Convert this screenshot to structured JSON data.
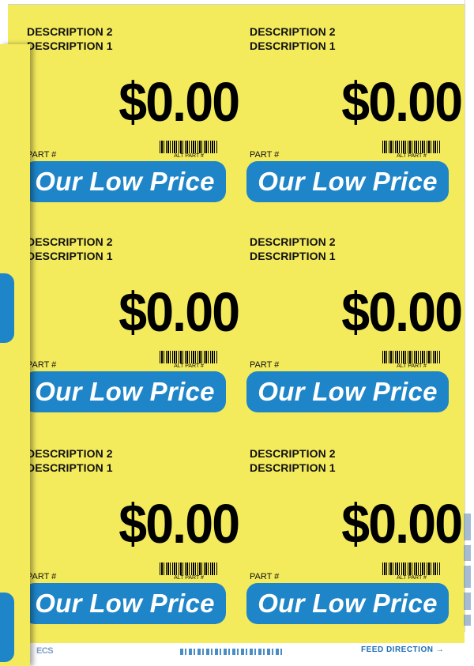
{
  "labels": [
    {
      "description2": "DESCRIPTION 2",
      "description1": "DESCRIPTION 1",
      "price": "$0.00",
      "part": "PART #",
      "alt_part": "ALT PART #",
      "tagline": "Our Low Price"
    },
    {
      "description2": "DESCRIPTION 2",
      "description1": "DESCRIPTION 1",
      "price": "$0.00",
      "part": "PART #",
      "alt_part": "ALT PART #",
      "tagline": "Our Low Price"
    },
    {
      "description2": "DESCRIPTION 2",
      "description1": "DESCRIPTION 1",
      "price": "$0.00",
      "part": "PART #",
      "alt_part": "ALT PART #",
      "tagline": "Our Low Price"
    },
    {
      "description2": "DESCRIPTION 2",
      "description1": "DESCRIPTION 1",
      "price": "$0.00",
      "part": "PART #",
      "alt_part": "ALT PART #",
      "tagline": "Our Low Price"
    },
    {
      "description2": "DESCRIPTION 2",
      "description1": "DESCRIPTION 1",
      "price": "$0.00",
      "part": "PART #",
      "alt_part": "ALT PART #",
      "tagline": "Our Low Price"
    },
    {
      "description2": "DESCRIPTION 2",
      "description1": "DESCRIPTION 1",
      "price": "$0.00",
      "part": "PART #",
      "alt_part": "ALT PART #",
      "tagline": "Our Low Price"
    }
  ],
  "footer": {
    "logo": "ECS",
    "feed_direction": "FEED DIRECTION →"
  },
  "colors": {
    "sheet": "#f3ea5c",
    "pill": "#1d85c8",
    "footer_text": "#1d6fb5"
  }
}
